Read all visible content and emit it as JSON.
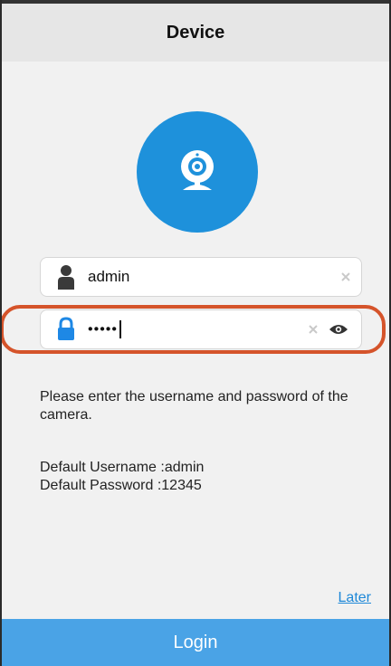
{
  "header": {
    "title": "Device"
  },
  "form": {
    "username": {
      "value": "admin"
    },
    "password": {
      "masked_value": "•••••"
    }
  },
  "info": {
    "prompt": "Please enter the username and password of the camera.",
    "default_username": "Default Username :admin",
    "default_password": "Default Password :12345"
  },
  "actions": {
    "later": "Later",
    "login": "Login"
  },
  "colors": {
    "accent": "#1e91db",
    "login_bg": "#4aa3e6",
    "highlight": "#d5542b"
  },
  "icons": {
    "avatar": "webcam-icon",
    "username": "person-icon",
    "password": "lock-icon",
    "clear": "clear-x-icon",
    "toggle": "eye-icon"
  }
}
